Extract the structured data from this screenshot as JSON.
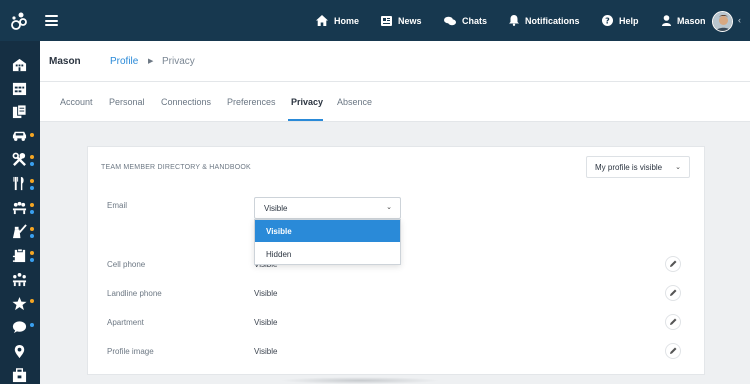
{
  "topbar": {
    "nav": [
      {
        "label": "Home",
        "icon": "home-icon"
      },
      {
        "label": "News",
        "icon": "news-icon"
      },
      {
        "label": "Chats",
        "icon": "chat-icon"
      },
      {
        "label": "Notifications",
        "icon": "bell-icon"
      },
      {
        "label": "Help",
        "icon": "help-icon"
      },
      {
        "label": "Mason",
        "icon": "user-icon"
      }
    ]
  },
  "sidebar": {
    "items": [
      {
        "icon": "building-icon",
        "dot": null
      },
      {
        "icon": "calendar-icon",
        "dot": null
      },
      {
        "icon": "documents-icon",
        "dot": null
      },
      {
        "icon": "car-icon",
        "dot": "orange"
      },
      {
        "icon": "tools-icon",
        "dot": "orange"
      },
      {
        "icon": "utensils-icon",
        "dot": "orange"
      },
      {
        "icon": "group-icon",
        "dot": "orange"
      },
      {
        "icon": "cleaning-icon",
        "dot": "orange"
      },
      {
        "icon": "clipboard-icon",
        "dot": "orange"
      },
      {
        "icon": "team-icon",
        "dot": null
      },
      {
        "icon": "star-icon",
        "dot": "orange"
      },
      {
        "icon": "comment-icon",
        "dot": "blue"
      },
      {
        "icon": "location-icon",
        "dot": null
      },
      {
        "icon": "briefcase-icon",
        "dot": null
      }
    ]
  },
  "header": {
    "name": "Mason",
    "breadcrumb_link": "Profile",
    "breadcrumb_current": "Privacy"
  },
  "tabs": [
    "Account",
    "Personal",
    "Connections",
    "Preferences",
    "Privacy",
    "Absence"
  ],
  "active_tab": "Privacy",
  "card": {
    "title": "TEAM MEMBER DIRECTORY & HANDBOOK",
    "visibility_value": "My profile is visible",
    "rows": [
      {
        "label": "Email",
        "value": "Visible"
      },
      {
        "label": "Cell phone",
        "value": "Visible"
      },
      {
        "label": "Landline phone",
        "value": "Visible"
      },
      {
        "label": "Apartment",
        "value": "Visible"
      },
      {
        "label": "Profile image",
        "value": "Visible"
      }
    ],
    "email_dropdown_options": [
      "Visible",
      "Hidden"
    ]
  },
  "colors": {
    "topbar": "#17384f",
    "sidebar": "#152f43",
    "accent": "#2a8ad8",
    "dot_orange": "#f5a623",
    "dot_blue": "#3aa0f0"
  }
}
